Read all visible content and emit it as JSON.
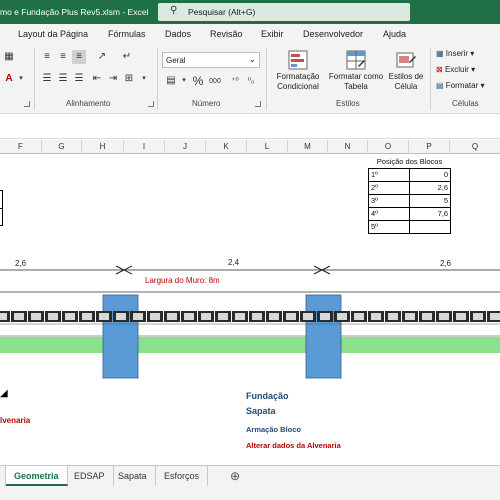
{
  "title": {
    "file_title": "mo e Fundação Plus Rev5.xlsm  -  Excel",
    "search_placeholder": "Pesquisar (Alt+G)"
  },
  "menu": [
    "Layout da Página",
    "Fórmulas",
    "Dados",
    "Revisão",
    "Exibir",
    "Desenvolvedor",
    "Ajuda"
  ],
  "ribbon": {
    "groups": {
      "alignment": "Alinhamento",
      "number": "Número",
      "styles": "Estilos",
      "cells": "Células"
    },
    "number_format": "Geral",
    "percent": "%",
    "comma": "000",
    "styles_buttons": [
      {
        "label": "Formatação\nCondicional"
      },
      {
        "label": "Formatar como\nTabela"
      },
      {
        "label": "Estilos de\nCélula"
      }
    ],
    "cells_buttons": [
      "Inserir",
      "Excluir",
      "Formatar"
    ]
  },
  "columns": [
    "F",
    "G",
    "H",
    "I",
    "J",
    "K",
    "L",
    "M",
    "N",
    "O",
    "P",
    "Q"
  ],
  "blocks_table": {
    "header": "Posição dos Blocos",
    "rows": [
      {
        "label": "1º",
        "value": "0"
      },
      {
        "label": "2º",
        "value": "2,6"
      },
      {
        "label": "3º",
        "value": "5"
      },
      {
        "label": "4º",
        "value": "7,6"
      },
      {
        "label": "5º",
        "value": ""
      }
    ]
  },
  "drawing": {
    "dim_left": "2,6",
    "dim_mid": "2,4",
    "dim_right": "2,6",
    "wall_length": "Largura do Muro: 8m"
  },
  "links": {
    "fundacao": "Fundação",
    "sapata": "Sapata",
    "armacao": "Armação Bloco",
    "alterar": "Alterar dados da Alvenaria",
    "alvenaria_cut": "lvenaria"
  },
  "tabs": [
    "Geometria",
    "EDSAP",
    "Sapata",
    "Esforços"
  ],
  "colors": {
    "excel_green": "#1f7145",
    "block_blue": "#5b9bd5",
    "ground_green": "#8be08b",
    "link_blue": "#1f4e79",
    "link_red": "#c00000"
  }
}
